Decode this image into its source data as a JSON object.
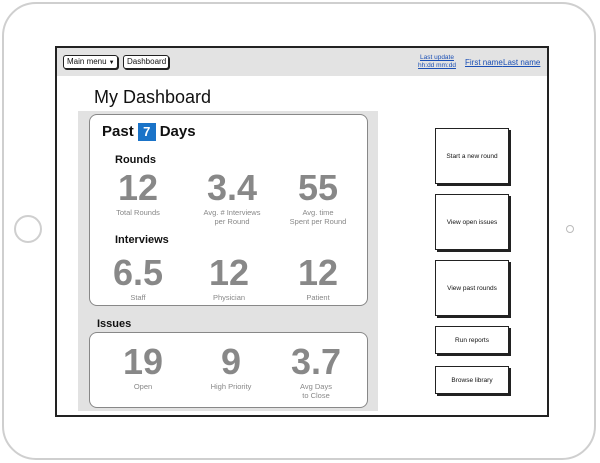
{
  "topbar": {
    "main_menu_label": "Main menu",
    "dashboard_label": "Dashboard",
    "last_update_line1": "Last update",
    "last_update_line2": "hh:dd mm:dd",
    "first_name": "First name",
    "last_name": "Last name"
  },
  "page": {
    "title": "My Dashboard"
  },
  "period": {
    "prefix": "Past",
    "days": "7",
    "suffix": "Days"
  },
  "rounds": {
    "label": "Rounds",
    "metrics": [
      {
        "value": "12",
        "label": "Total Rounds",
        "label2": ""
      },
      {
        "value": "3.4",
        "label": "Avg. # Interviews",
        "label2": "per Round"
      },
      {
        "value": "55",
        "label": "Avg. time",
        "label2": "Spent per Round"
      }
    ]
  },
  "interviews": {
    "label": "Interviews",
    "metrics": [
      {
        "value": "6.5",
        "label": "Staff"
      },
      {
        "value": "12",
        "label": "Physician"
      },
      {
        "value": "12",
        "label": "Patient"
      }
    ]
  },
  "issues": {
    "label": "Issues",
    "metrics": [
      {
        "value": "19",
        "label": "Open",
        "label2": ""
      },
      {
        "value": "9",
        "label": "High Priority",
        "label2": ""
      },
      {
        "value": "3.7",
        "label": "Avg Days",
        "label2": "to Close"
      }
    ]
  },
  "actions": {
    "start_round": "Start a new round",
    "view_open_issues": "View open issues",
    "view_past_rounds": "View past rounds",
    "run_reports": "Run reports",
    "browse_library": "Browse library"
  }
}
